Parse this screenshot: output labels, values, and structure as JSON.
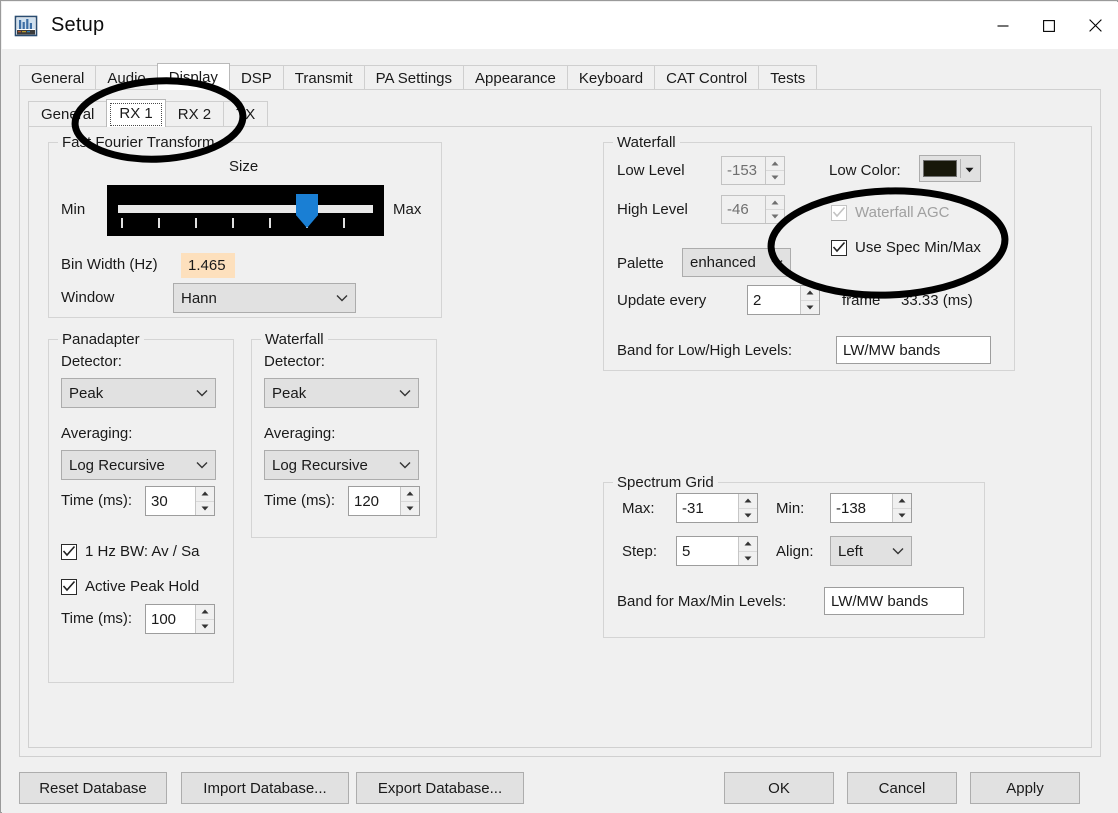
{
  "window": {
    "title": "Setup",
    "app_icon": "spectrum-window-icon",
    "controls": {
      "minimize": "minimize-icon",
      "maximize": "maximize-icon",
      "close": "close-icon"
    }
  },
  "outer_tabs": {
    "active": "Display",
    "items": [
      {
        "label": "General"
      },
      {
        "label": "Audio"
      },
      {
        "label": "Display"
      },
      {
        "label": "DSP"
      },
      {
        "label": "Transmit"
      },
      {
        "label": "PA Settings"
      },
      {
        "label": "Appearance"
      },
      {
        "label": "Keyboard"
      },
      {
        "label": "CAT Control"
      },
      {
        "label": "Tests"
      }
    ]
  },
  "inner_tabs": {
    "active": "RX 1",
    "items": [
      {
        "label": "General"
      },
      {
        "label": "RX 1"
      },
      {
        "label": "RX 2"
      },
      {
        "label": "TX"
      }
    ]
  },
  "fft": {
    "legend": "Fast Fourier Transform",
    "size_label": "Size",
    "min_label": "Min",
    "max_label": "Max",
    "slider_ticks": 7,
    "slider_position_index": 6,
    "bin_width_label": "Bin Width (Hz)",
    "bin_width_value": "1.465",
    "window_label": "Window",
    "window_value": "Hann"
  },
  "panadapter": {
    "legend": "Panadapter",
    "detector_label": "Detector:",
    "detector_value": "Peak",
    "averaging_label": "Averaging:",
    "averaging_value": "Log Recursive",
    "time_label": "Time (ms):",
    "time_value": "30",
    "checkbox_1hz_bw": "1 Hz BW: Av / Sa",
    "checkbox_1hz_bw_checked": true,
    "checkbox_active_peak_hold": "Active Peak Hold",
    "checkbox_active_peak_hold_checked": true,
    "peak_hold_time_label": "Time (ms):",
    "peak_hold_time_value": "100"
  },
  "waterfall_left": {
    "legend": "Waterfall",
    "detector_label": "Detector:",
    "detector_value": "Peak",
    "averaging_label": "Averaging:",
    "averaging_value": "Log Recursive",
    "time_label": "Time (ms):",
    "time_value": "120"
  },
  "waterfall_right": {
    "legend": "Waterfall",
    "low_level_label": "Low Level",
    "low_level_value": "-153",
    "high_level_label": "High Level",
    "high_level_value": "-46",
    "low_color_label": "Low Color:",
    "low_color_value": "#17170a",
    "waterfall_agc_label": "Waterfall AGC",
    "waterfall_agc_checked": true,
    "waterfall_agc_enabled": false,
    "use_spec_minmax_label": "Use Spec Min/Max",
    "use_spec_minmax_checked": true,
    "palette_label": "Palette",
    "palette_value": "enhanced",
    "update_every_label": "Update every",
    "update_every_value": "2",
    "frame_label": "frame",
    "frame_ms": "33.33 (ms)",
    "band_label": "Band for Low/High Levels:",
    "band_value": "LW/MW bands"
  },
  "spectrum_grid": {
    "legend": "Spectrum Grid",
    "max_label": "Max:",
    "max_value": "-31",
    "min_label": "Min:",
    "min_value": "-138",
    "step_label": "Step:",
    "step_value": "5",
    "align_label": "Align:",
    "align_value": "Left",
    "band_label": "Band for Max/Min Levels:",
    "band_value": "LW/MW bands"
  },
  "buttons": {
    "reset_database": "Reset Database",
    "import_database": "Import Database...",
    "export_database": "Export Database...",
    "ok": "OK",
    "cancel": "Cancel",
    "apply": "Apply"
  },
  "annotations": {
    "ellipse_1_target": "RX 1 tab",
    "ellipse_2_target": "Waterfall AGC / Use Spec Min/Max checkboxes",
    "color": "#000000"
  }
}
